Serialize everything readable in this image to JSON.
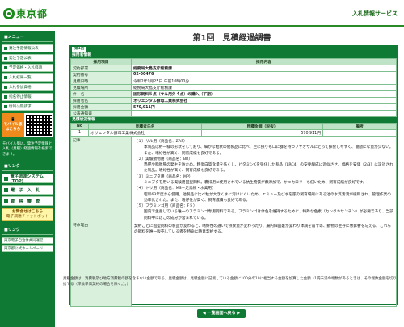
{
  "header": {
    "logo_text": "東京都",
    "service": "入札情報サービス"
  },
  "sidebar": {
    "menu_title": "■メニュー",
    "items": [
      {
        "label": "発注予定情報公表"
      },
      {
        "label": "発注予定公表"
      },
      {
        "label": "予定価格・入札経過"
      },
      {
        "label": "入札結果一覧"
      },
      {
        "label": "入札参加資格"
      },
      {
        "label": "指名停止情報"
      },
      {
        "label": "情報公開請求"
      }
    ],
    "mobile_label_1": "モバイル版",
    "mobile_label_2": "はこちら",
    "note": "モバイル版は、発注予定情報と入札（見積）経過情報を検索できます。",
    "links_title": "■リンク",
    "links": [
      {
        "label": "電子調達システム(TOP)"
      },
      {
        "label": "電　子　入　札"
      },
      {
        "label": "資　格　審　査"
      }
    ],
    "notice_1": "お問合せはこちら",
    "notice_2": "電子調達チャットボット",
    "sublinks_title": "■リンク",
    "sublinks": [
      {
        "label": "東京電子自治体共同運営"
      },
      {
        "label": "東京都公式ホームページ"
      }
    ]
  },
  "main": {
    "title": "第1回　見積経過調書",
    "tab": "第1回",
    "section_1": "採用者情報",
    "col_item": "採用項目",
    "col_content": "採用内容",
    "rows": [
      {
        "label": "契約部署",
        "value": "総務局大島支庁総務課"
      },
      {
        "label": "契約番号",
        "value": "02-00476"
      },
      {
        "label": "見積日時",
        "value": "令和2年9月25日 午前10時00分"
      },
      {
        "label": "見積場所",
        "value": "総務局大島支庁総務課"
      },
      {
        "label": "件　名",
        "value": "固形飼料５点（サル用外４点）の購入（下期）"
      },
      {
        "label": "採用者名",
        "value": "オリエンタル酵母工業株式会社"
      },
      {
        "label": "採用金額",
        "value": "570,911円"
      },
      {
        "label": "公表通知書",
        "value": ""
      }
    ],
    "section_2": "見積状況情報",
    "bid_head": {
      "no": "No",
      "name": "見積者氏名",
      "amount": "見積金額（税抜）",
      "remark": "備考"
    },
    "bids": [
      {
        "no": "1",
        "name": "オリエンタル酵母工業株式会社",
        "amount": "570,911円",
        "remark": ""
      }
    ],
    "remark_label": "記事",
    "special_label": "特命理由",
    "remarks": [
      "（１）サル用（商品名：ZAS）",
      "本製品は約一様の形状をしており、細かな粒状の他製品に比べ、主に摂りもロに群を持つフサオサルにとって採食しやすく、簡励にな量が少ない。また、嗜好性が高く、飼育成績も良好である。",
      "（２）実験動物用（商品名：BR）",
      "過肥や脂肪肝の発生を防ため、粗蛋白質含量を低くし、ビタミンCを強化した製品（LRC4）の安要組成に近似させ、価格を安価（2/3）に設計された製品。嗜好性が高く、飼育成績も良好である。",
      "（３）ミニブタ用（商品名：MP）",
      "ミニブタを用いる実験用固型飼料。嚢排用に使用されている抗生物質が無添加で、かつカロリーも低いため、飼育成績が良好です。",
      "（４）トリ用（商品名：MS＝走鳥類・水禽用）",
      "昭和63年度から使用。他製品に比べ粒が大きく水に溶けにくいため、エミュー及び水を張の飼育場所にある池の水質汚濁が緩和され、管理作業の効率化された。また、嗜好性が高く、飼育成績も良好である。",
      "（５）フラミンゴ用（商品名：F５）",
      "国内で生産している唯一のフラミンゴ専用飼料である。フラミンゴは体色を維持するために、特殊な色素（カンタキサンチン）が必要であり、当該飼料中にはこの成分が含まれている。",
      "契約ごとに固型飼料の製品が変わると、嗜好性の違いで摂食量が変わったり、腸内細菌叢が変わり体調を崩す等、動物の生存に悪影響を与える。これらの飼料を唯一販売している者を特命に随意契約する。"
    ]
  },
  "footnote": "見積金額は、消費税及び地方消費税の額を含まない金額である。見積金額は、見積金額に記載している金額に100分の10に相当する金額を加算した金額（1円未満の端数があるときは、その端数金額を切り捨てる（単数単価契約の場合を除く。）。）",
  "back_button": "一覧画面へ戻る",
  "colors": {
    "brand": "#0e7a34",
    "header_green": "#1a8a1a",
    "cell_label": "#d8f0dc"
  }
}
